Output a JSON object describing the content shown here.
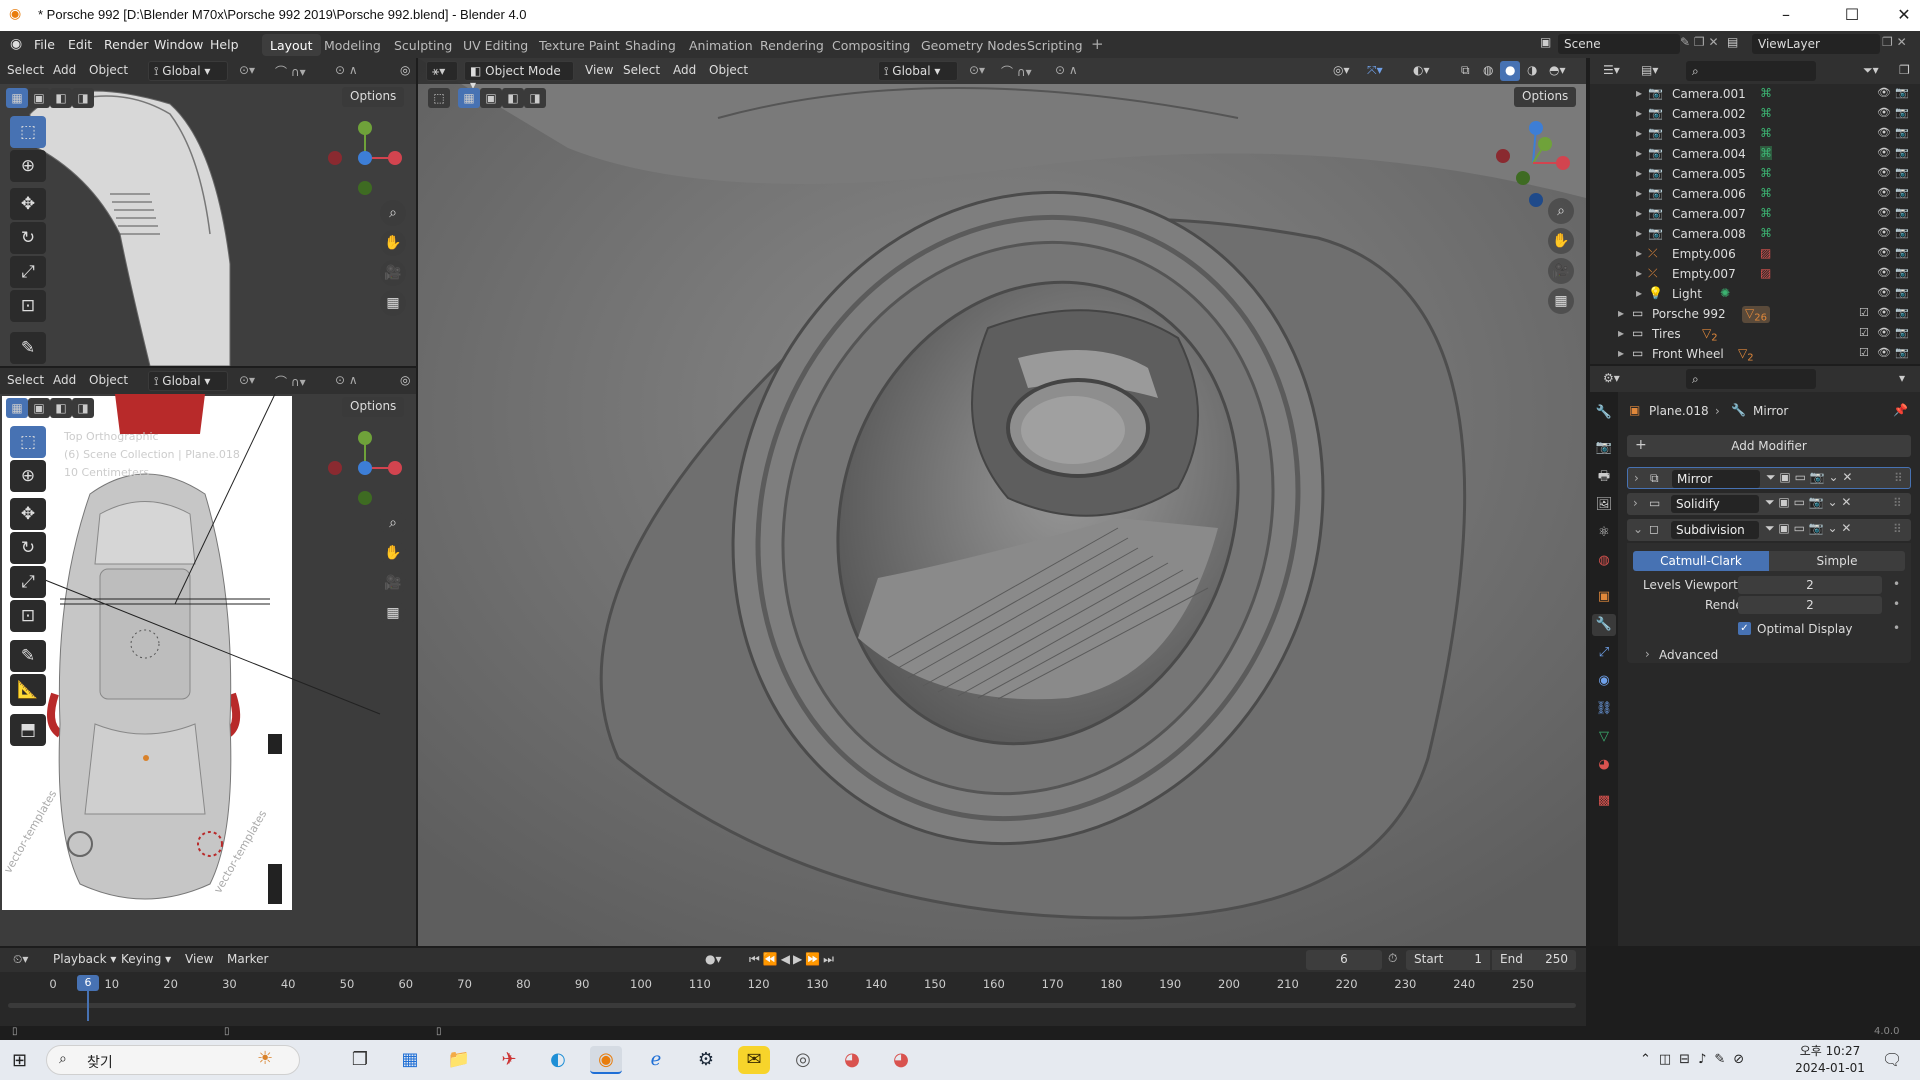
{
  "window": {
    "title": "* Porsche 992 [D:\\Blender M70x\\Porsche 992 2019\\Porsche 992.blend] - Blender 4.0"
  },
  "menu": [
    "File",
    "Edit",
    "Render",
    "Window",
    "Help"
  ],
  "workspaces": [
    "Layout",
    "Modeling",
    "Sculpting",
    "UV Editing",
    "Texture Paint",
    "Shading",
    "Animation",
    "Rendering",
    "Compositing",
    "Geometry Nodes",
    "Scripting"
  ],
  "active_workspace": "Layout",
  "scene": {
    "name": "Scene",
    "view_layer": "ViewLayer"
  },
  "viewport_small": {
    "menus": [
      "Select",
      "Add",
      "Object"
    ],
    "orientation": "Global",
    "options": "Options"
  },
  "viewport_bottom": {
    "menus": [
      "Select",
      "Add",
      "Object"
    ],
    "orientation": "Global",
    "options": "Options",
    "overlay_text": [
      "Top Orthographic",
      "(6) Scene Collection | Plane.018",
      "10 Centimeters"
    ]
  },
  "viewport_main": {
    "mode": "Object Mode",
    "menus": [
      "View",
      "Select",
      "Add",
      "Object"
    ],
    "orientation": "Global",
    "options": "Options"
  },
  "outliner": {
    "rows": [
      {
        "name": "Camera.001",
        "type": "camera"
      },
      {
        "name": "Camera.002",
        "type": "camera"
      },
      {
        "name": "Camera.003",
        "type": "camera"
      },
      {
        "name": "Camera.004",
        "type": "camera"
      },
      {
        "name": "Camera.005",
        "type": "camera"
      },
      {
        "name": "Camera.006",
        "type": "camera"
      },
      {
        "name": "Camera.007",
        "type": "camera"
      },
      {
        "name": "Camera.008",
        "type": "camera"
      },
      {
        "name": "Empty.006",
        "type": "empty"
      },
      {
        "name": "Empty.007",
        "type": "empty"
      },
      {
        "name": "Light",
        "type": "light"
      },
      {
        "name": "Porsche 992",
        "type": "collection",
        "badge": "26"
      },
      {
        "name": "Tires",
        "type": "collection",
        "badge": "2"
      },
      {
        "name": "Front Wheel",
        "type": "collection",
        "badge": "2"
      }
    ]
  },
  "properties": {
    "breadcrumb_object": "Plane.018",
    "breadcrumb_modifier": "Mirror",
    "add_modifier": "Add Modifier",
    "modifiers": [
      "Mirror",
      "Solidify",
      "Subdivision"
    ],
    "subdivision": {
      "mode_a": "Catmull-Clark",
      "mode_b": "Simple",
      "levels_label": "Levels Viewport",
      "levels_value": "2",
      "render_label": "Render",
      "render_value": "2",
      "optimal_display": "Optimal Display",
      "advanced": "Advanced"
    }
  },
  "timeline": {
    "menus": [
      "Playback",
      "Keying",
      "View",
      "Marker"
    ],
    "current_frame": "6",
    "start_label": "Start",
    "start": "1",
    "end_label": "End",
    "end": "250",
    "ticks": [
      "0",
      "10",
      "20",
      "30",
      "40",
      "50",
      "60",
      "70",
      "80",
      "90",
      "100",
      "110",
      "120",
      "130",
      "140",
      "150",
      "160",
      "170",
      "180",
      "190",
      "200",
      "210",
      "220",
      "230",
      "240",
      "250"
    ]
  },
  "status": {
    "version": "4.0.0"
  },
  "taskbar": {
    "search_label": "찾기",
    "time": "오후 10:27",
    "date": "2024-01-01"
  },
  "colors": {
    "accent": "#4772b3",
    "axis_x": "#d2444f",
    "axis_y": "#6fa23a",
    "axis_z": "#3d7ed6"
  }
}
